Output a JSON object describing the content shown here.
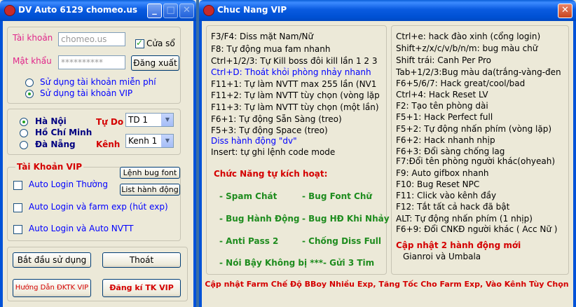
{
  "left_window": {
    "title": "DV Auto 6129 chomeo.us",
    "title_buttons": [
      "_",
      "□",
      "✕"
    ],
    "account_label": "Tài khoản",
    "account_value": "chomeo.us",
    "password_label": "Mật khẩu",
    "password_value": "**********",
    "window_checkbox_label": "Cửa sổ",
    "window_checkbox_checked": true,
    "logout_button": "Đăng xuất",
    "account_type": [
      {
        "label": "Sử dụng tài khoản miễn phí",
        "selected": false
      },
      {
        "label": "Sử dụng tài khoản VIP",
        "selected": true
      }
    ],
    "servers": [
      {
        "label": "Hà Nội",
        "selected": true
      },
      {
        "label": "Hồ Chí Minh",
        "selected": false
      },
      {
        "label": "Đà Nẵng",
        "selected": false
      }
    ],
    "freedom_label": "Tự Do",
    "freedom_value": "TD 1",
    "channel_label": "Kênh",
    "channel_value": "Kenh 1",
    "vip_section_title": "Tài Khoản VIP",
    "font_bug_button": "Lệnh bug font",
    "action_list_button": "List hành động",
    "vip_options": [
      {
        "label": "Auto Login Thường",
        "checked": false
      },
      {
        "label": "Auto Login và farm exp (hút exp)",
        "checked": false
      },
      {
        "label": "Auto Login và Auto NVTT",
        "checked": false
      }
    ],
    "start_button": "Bắt đầu sử dụng",
    "exit_button": "Thoát",
    "guide_button": "Hướng Dẫn ĐKTK VIP",
    "register_button": "Đăng kí TK VIP"
  },
  "right_window": {
    "title": "Chuc Nang VIP",
    "left_column": [
      {
        "text": "F3/F4: Diss mặt Nam/Nữ",
        "color": "#000000"
      },
      {
        "text": "F8: Tự động mua fam nhanh",
        "color": "#000000"
      },
      {
        "text": "Ctrl+1/2/3: Tự Kill boss đôi kill lần 1 2 3",
        "color": "#000000"
      },
      {
        "text": "Ctrl+D: Thoát khỏi phòng nhảy nhanh",
        "color": "#0000ff"
      },
      {
        "text": "F11+1: Tự làm NVTT max 255 lần (NV1",
        "color": "#000000"
      },
      {
        "text": "F11+2: Tự làm NVTT tùy chọn (vòng lặp",
        "color": "#000000"
      },
      {
        "text": "F11+3: Tự làm NVTT tùy chọn (một lần)",
        "color": "#000000"
      },
      {
        "text": "F6+1: Tự động Sẵn Sàng (treo)",
        "color": "#000000"
      },
      {
        "text": "F5+3: Tự động Space (treo)",
        "color": "#000000"
      },
      {
        "text": "Diss hành động \"dv\"",
        "color": "#0000ff"
      },
      {
        "text": "Insert: tự ghi lệnh code mode",
        "color": "#000000"
      }
    ],
    "auto_title": "Chức Năng tự kích hoạt:",
    "auto_features": [
      [
        "- Spam Chát",
        "- Bug Font Chữ"
      ],
      [
        "- Bug Hành Động",
        "- Bug HĐ Khi Nhảy"
      ],
      [
        "- Anti Pass 2",
        "- Chống Diss Full"
      ],
      [
        "- Nói Bậy Không bị ***",
        "- Gửi 3 Tim"
      ]
    ],
    "right_column": [
      "Ctrl+e: hack đào xinh (cổng login)",
      "Shift+z/x/c/v/b/n/m: bug màu chữ",
      "Shift trái: Canh Per Pro",
      "Tab+1/2/3:Bug màu da(trắng-vàng-đen",
      "F6+5/6/7: Hack great/cool/bad",
      "Ctrl+4: Hack Reset LV",
      "F2: Tạo tên phòng dài",
      "F5+1: Hack Perfect full",
      "F5+2: Tự động nhấn phím (vòng lặp)",
      "F6+2: Hack nhanh nhịp",
      "F6+3: Đổi sàng chống lag",
      "F7:Đổi tên phòng người khác(ohyeah)",
      "F9: Auto gifbox nhanh",
      "F10: Bug Reset NPC",
      "F11: Click vào kênh đầy",
      "F12: Tắt tất cả hack đã bật",
      "ALT: Tự động nhấn phím (1 nhịp)",
      "F6+9: Đổi CNKĐ người khác ( Acc Nữ )"
    ],
    "update_title": "Cập nhật 2 hành động mới",
    "update_text": "Gianroi và Umbala",
    "footer": "Cập nhật Farm Chế Độ BBoy Nhiều Exp, Tăng Tốc Cho Farm Exp, Vào Kênh Tùy Chọn"
  },
  "colors": {
    "title_bar": "#0a5be0",
    "window_bg": "#ece9d8",
    "accent_red": "#d40000",
    "accent_pink": "#e0268a",
    "feature_green": "#1e8c1e"
  }
}
